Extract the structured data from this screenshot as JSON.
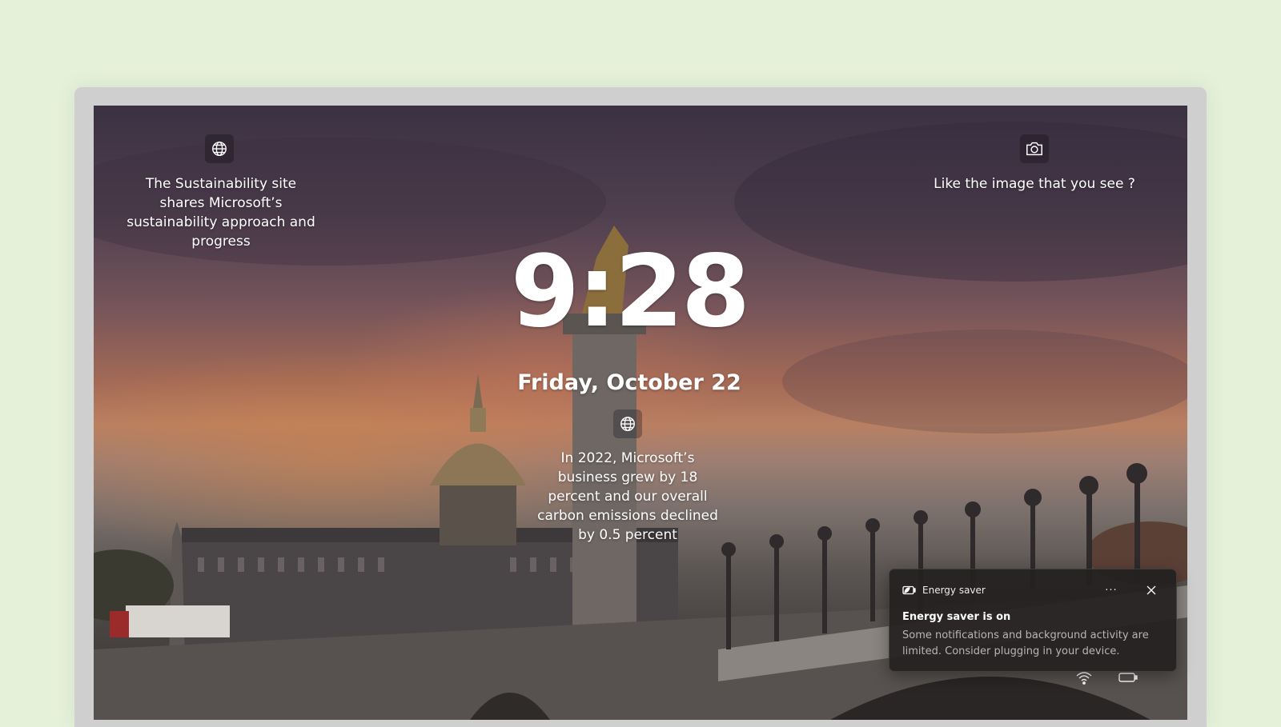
{
  "lockscreen": {
    "top_left_caption": "The Sustainability site shares Microsoft’s sustainability approach and progress",
    "top_right_caption": "Like the image that you see ?",
    "time": "9:28",
    "date": "Friday, October 22",
    "fact": "In 2022, Microsoft’s business grew by 18 percent and our overall carbon emissions declined by 0.5 percent"
  },
  "icons": {
    "top_left": "globe-icon",
    "top_right": "camera-icon",
    "center": "globe-icon",
    "toast_app": "energy-saver-icon",
    "tray_network": "wifi-icon",
    "tray_battery": "battery-icon"
  },
  "toast": {
    "app_name": "Energy saver",
    "more_label": "···",
    "title": "Energy saver is on",
    "body": "Some notifications and background activity are limited. Consider plugging in your device."
  },
  "colors": {
    "page_background": "#e6f1da",
    "device_frame": "#cfcfcf",
    "toast_background": "#242020"
  }
}
